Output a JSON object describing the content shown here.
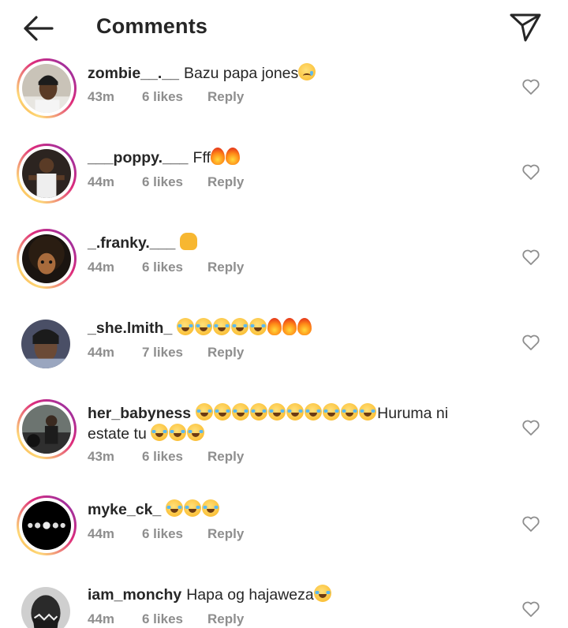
{
  "header": {
    "title": "Comments",
    "back_icon": "arrow-left-icon",
    "share_icon": "paper-plane-icon"
  },
  "comments": [
    {
      "username": "zombie__.__",
      "text": "Bazu papa jones",
      "emoji": [
        "sad"
      ],
      "time": "43m",
      "likes": "6 likes",
      "reply": "Reply",
      "story_ring": true
    },
    {
      "username": "___poppy.___",
      "text": "Fff",
      "emoji": [
        "fire",
        "fire"
      ],
      "time": "44m",
      "likes": "6 likes",
      "reply": "Reply",
      "story_ring": true
    },
    {
      "username": "_.franky.___",
      "text": "",
      "emoji": [
        "raising-hands"
      ],
      "time": "44m",
      "likes": "6 likes",
      "reply": "Reply",
      "story_ring": true
    },
    {
      "username": "_she.lmith_",
      "text": "",
      "emoji": [
        "laugh",
        "laugh",
        "laugh",
        "laugh",
        "laugh",
        "fire",
        "fire",
        "fire"
      ],
      "time": "44m",
      "likes": "7 likes",
      "reply": "Reply",
      "story_ring": false
    },
    {
      "username": "her_babyness",
      "text_line1_suffix": "Huruma ni",
      "text_line2": "estate tu",
      "time": "43m",
      "likes": "6 likes",
      "reply": "Reply",
      "story_ring": true
    },
    {
      "username": "myke_ck_",
      "text": "",
      "emoji": [
        "laugh",
        "laugh",
        "laugh"
      ],
      "time": "44m",
      "likes": "6 likes",
      "reply": "Reply",
      "story_ring": true
    },
    {
      "username": "iam_monchy",
      "text": "Hapa og hajaweza",
      "emoji": [
        "laugh"
      ],
      "time": "44m",
      "likes": "6 likes",
      "reply": "Reply",
      "story_ring": false
    }
  ],
  "colors": {
    "text": "#262626",
    "meta": "#8e8e8e",
    "ring_start": "#f58529",
    "ring_end": "#8134af"
  }
}
